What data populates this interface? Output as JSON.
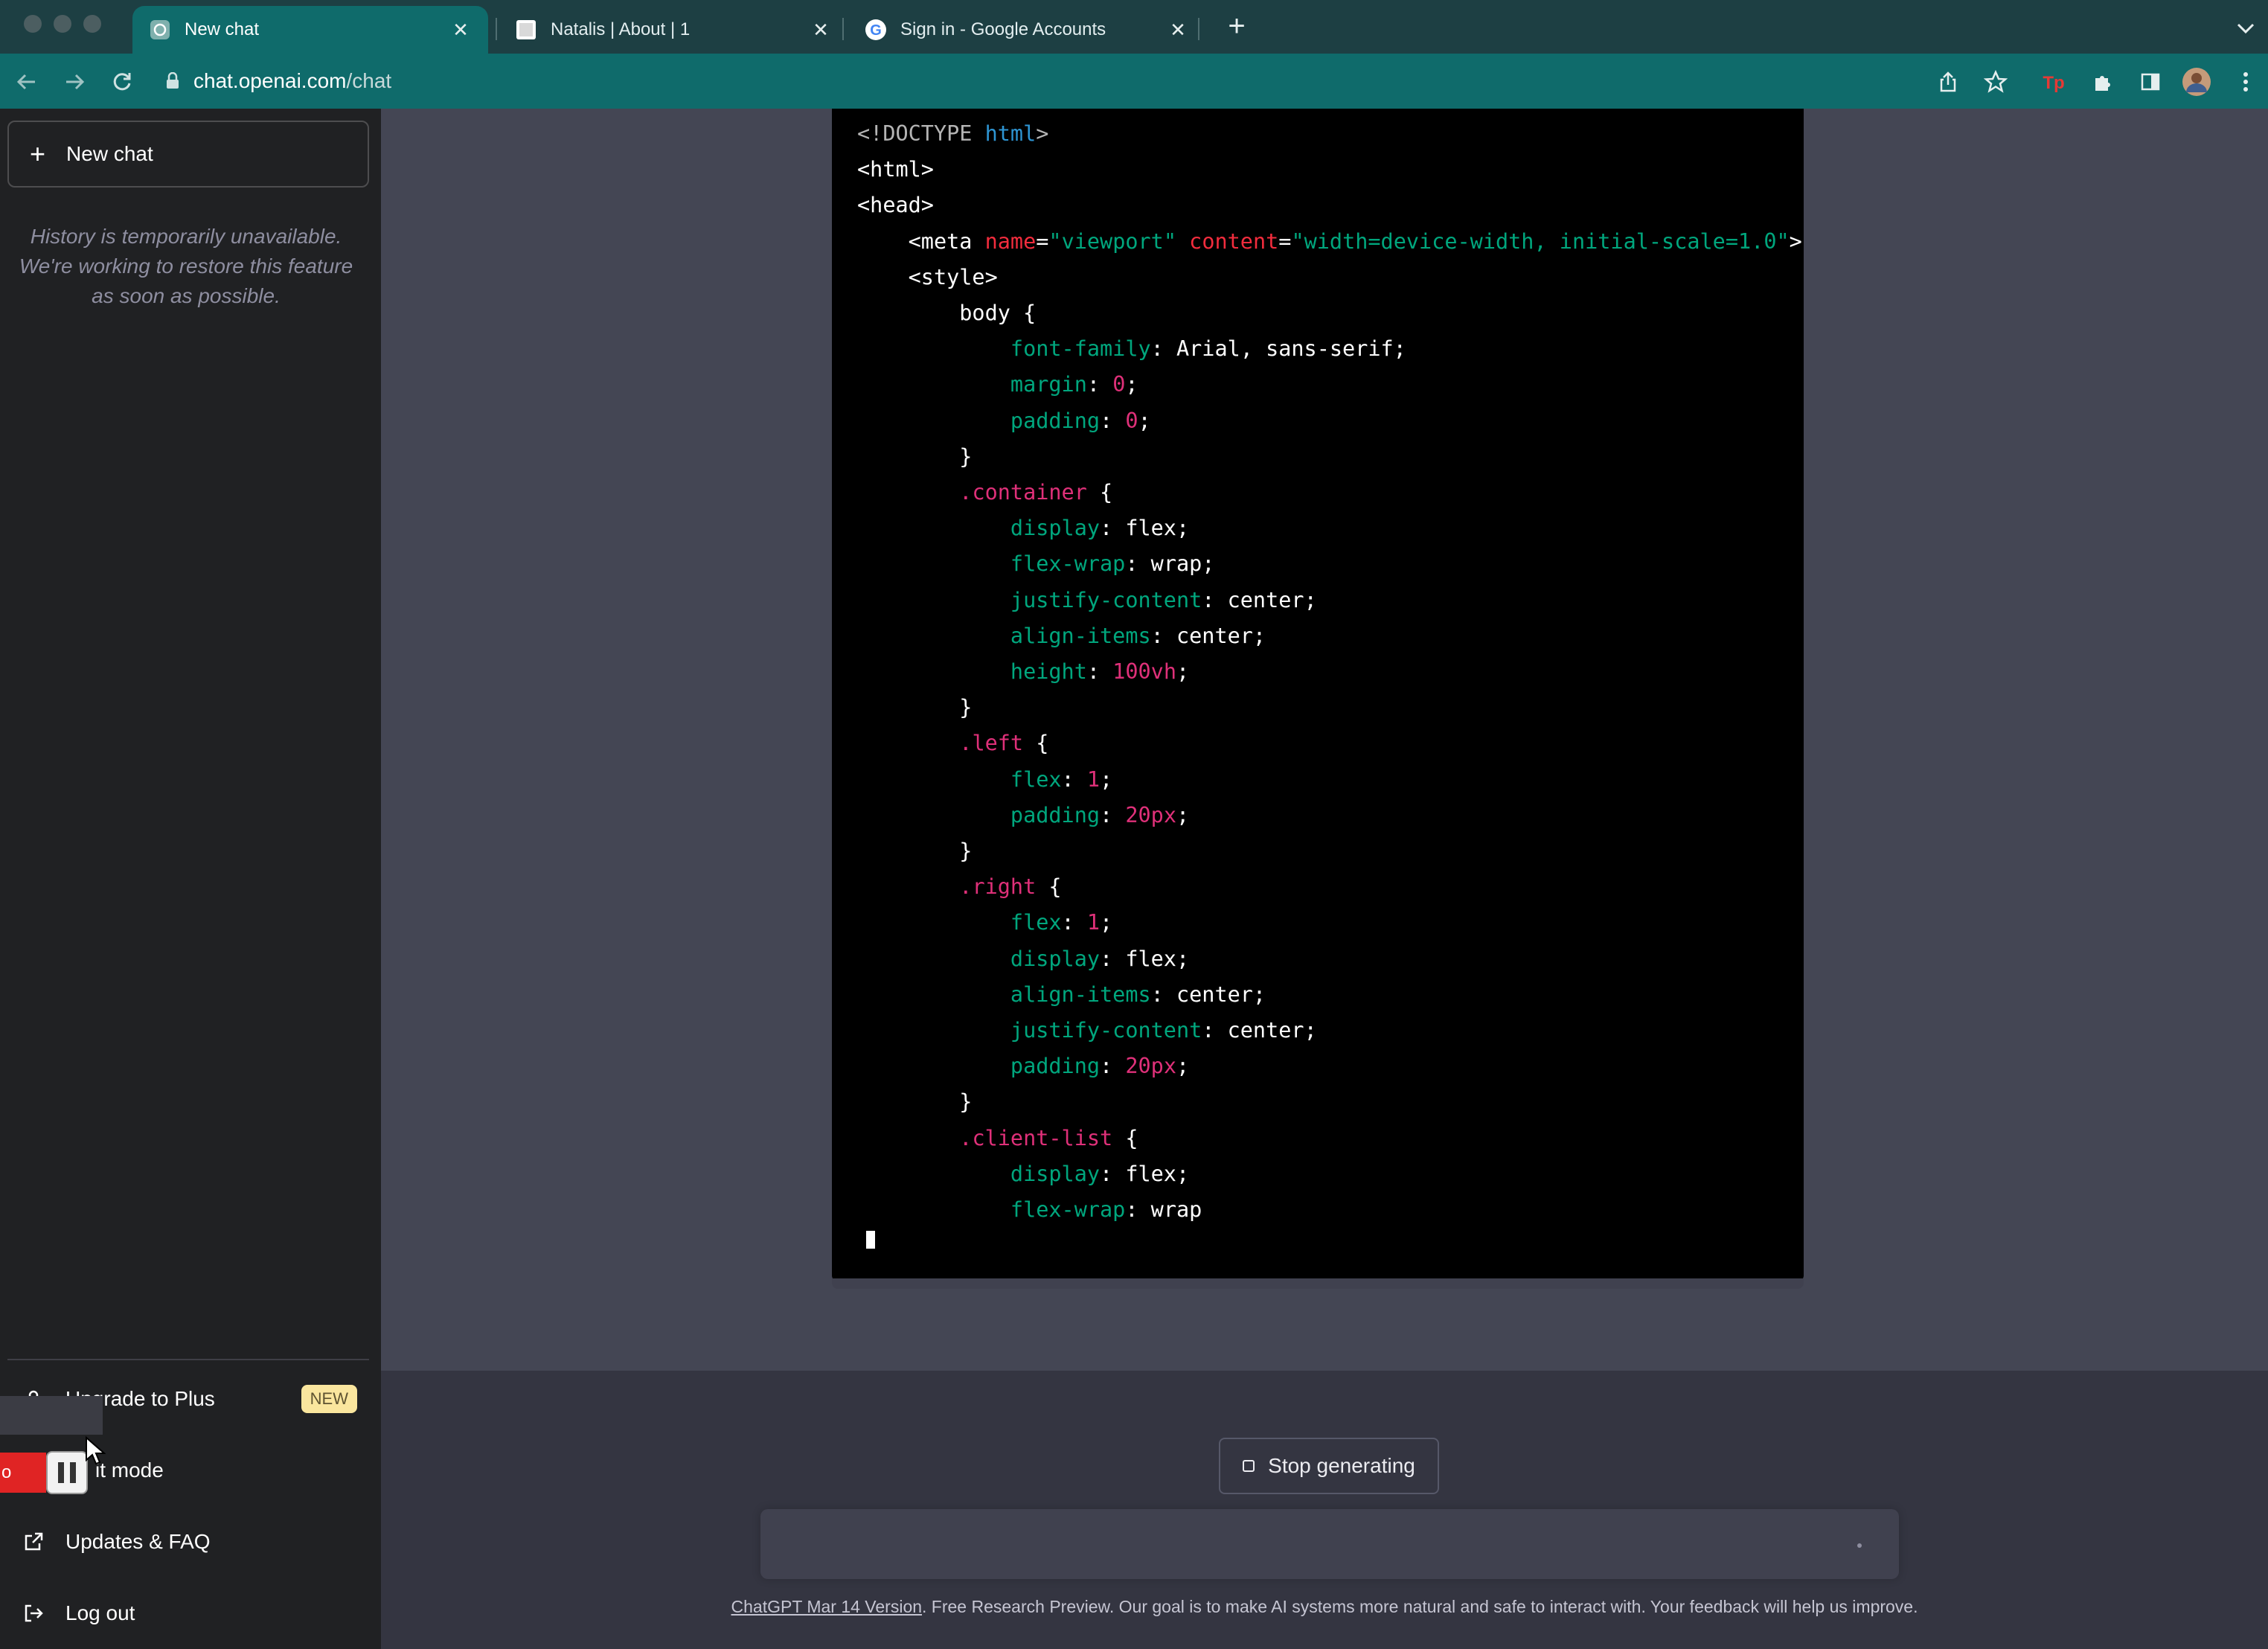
{
  "browser": {
    "tabs": [
      {
        "title": "New chat",
        "active": true
      },
      {
        "title": "Natalis | About | 1",
        "active": false
      },
      {
        "title": "Sign in - Google Accounts",
        "active": false
      }
    ],
    "url": {
      "host": "chat.openai.com",
      "path": "/chat"
    },
    "toolbar_icons": [
      "share-icon",
      "bookmark-star-icon",
      "extension-tp-icon",
      "extensions-puzzle-icon",
      "sidebar-icon",
      "profile-avatar",
      "kebab-menu-icon"
    ]
  },
  "sidebar": {
    "new_chat_label": "New chat",
    "history_message": "History is temporarily unavailable. We're working to restore this feature as soon as possible.",
    "items": [
      {
        "label": "Upgrade to Plus",
        "badge": "NEW",
        "icon": "user-icon"
      },
      {
        "label": "Light mode",
        "visible_label": "it mode",
        "icon": "sun-icon"
      },
      {
        "label": "Updates & FAQ",
        "icon": "external-link-icon"
      },
      {
        "label": "Log out",
        "icon": "logout-icon"
      }
    ]
  },
  "recording_overlay": {
    "label": "o"
  },
  "code": {
    "lines": [
      "<!DOCTYPE html>",
      "<html>",
      "<head>",
      "    <meta name=\"viewport\" content=\"width=device-width, initial-scale=1.0\">",
      "    <style>",
      "        body {",
      "            font-family: Arial, sans-serif;",
      "            margin: 0;",
      "            padding: 0;",
      "        }",
      "        .container {",
      "            display: flex;",
      "            flex-wrap: wrap;",
      "            justify-content: center;",
      "            align-items: center;",
      "            height: 100vh;",
      "        }",
      "        .left {",
      "            flex: 1;",
      "            padding: 20px;",
      "        }",
      "        .right {",
      "            flex: 1;",
      "            display: flex;",
      "            align-items: center;",
      "            justify-content: center;",
      "            padding: 20px;",
      "        }",
      "        .client-list {",
      "            display: flex;",
      "            flex-wrap: wrap"
    ]
  },
  "composer": {
    "stop_label": "Stop generating"
  },
  "footer": {
    "version_link": "ChatGPT Mar 14 Version",
    "text": ". Free Research Preview. Our goal is to make AI systems more natural and safe to interact with. Your feedback will help us improve."
  },
  "colors": {
    "sidebar": "#202123",
    "main": "#444654",
    "tab_active": "#0f6b6b",
    "badge": "#fae69e"
  }
}
